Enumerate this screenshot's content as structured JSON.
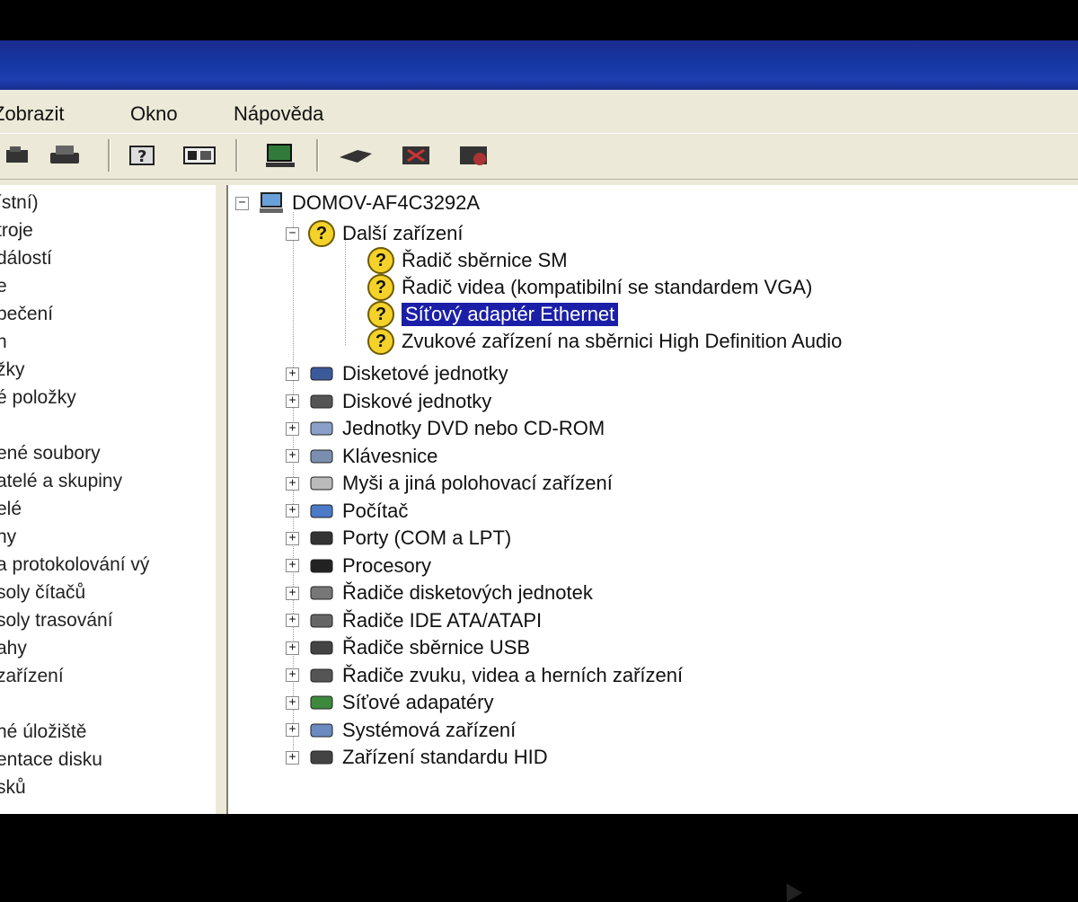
{
  "menu": {
    "view": "Zobrazit",
    "window": "Okno",
    "help": "Nápověda"
  },
  "toolbar": {
    "buttons": [
      "back-icon",
      "print-icon",
      "help-icon",
      "show-hide-icon",
      "computer-icon",
      "scan-icon",
      "uninstall-icon",
      "disable-icon"
    ]
  },
  "left_pane": {
    "items": [
      "ístní)",
      "troje",
      "dálostí",
      "e",
      "pečení",
      "n",
      "žky",
      "é položky",
      "",
      "ené soubory",
      "atelé a skupiny",
      "elé",
      "ny",
      "a protokolování vý",
      "soly čítačů",
      "soly trasování",
      "ahy",
      "zařízení",
      "",
      "né úložiště",
      "entace disku",
      "sků"
    ]
  },
  "tree": {
    "root": "DOMOV-AF4C3292A",
    "other_devices": {
      "label": "Další zařízení",
      "children": [
        "Řadič sběrnice SM",
        "Řadič videa (kompatibilní se standardem VGA)",
        "Síťový adaptér Ethernet",
        "Zvukové zařízení na sběrnici High Definition Audio"
      ],
      "selected": "Síťový adaptér Ethernet"
    },
    "categories": [
      {
        "label": "Disketové jednotky",
        "icon": "floppy-drive-icon"
      },
      {
        "label": "Diskové jednotky",
        "icon": "hard-disk-icon"
      },
      {
        "label": "Jednotky DVD nebo CD-ROM",
        "icon": "cd-drive-icon"
      },
      {
        "label": "Klávesnice",
        "icon": "keyboard-icon"
      },
      {
        "label": "Myši a jiná polohovací zařízení",
        "icon": "mouse-icon"
      },
      {
        "label": "Počítač",
        "icon": "computer-icon"
      },
      {
        "label": "Porty (COM a LPT)",
        "icon": "port-icon"
      },
      {
        "label": "Procesory",
        "icon": "processor-icon"
      },
      {
        "label": "Řadiče disketových jednotek",
        "icon": "floppy-controller-icon"
      },
      {
        "label": "Řadiče IDE ATA/ATAPI",
        "icon": "ide-controller-icon"
      },
      {
        "label": "Řadiče sběrnice USB",
        "icon": "usb-icon"
      },
      {
        "label": "Řadiče zvuku, videa a herních zařízení",
        "icon": "sound-icon"
      },
      {
        "label": "Síťové adapatéry",
        "icon": "network-adapter-icon"
      },
      {
        "label": "Systémová zařízení",
        "icon": "system-device-icon"
      },
      {
        "label": "Zařízení standardu HID",
        "icon": "hid-icon"
      }
    ]
  },
  "colors": {
    "titlebar": "#1538a6",
    "selection": "#1b1fa8",
    "warning": "#f4d22a"
  }
}
